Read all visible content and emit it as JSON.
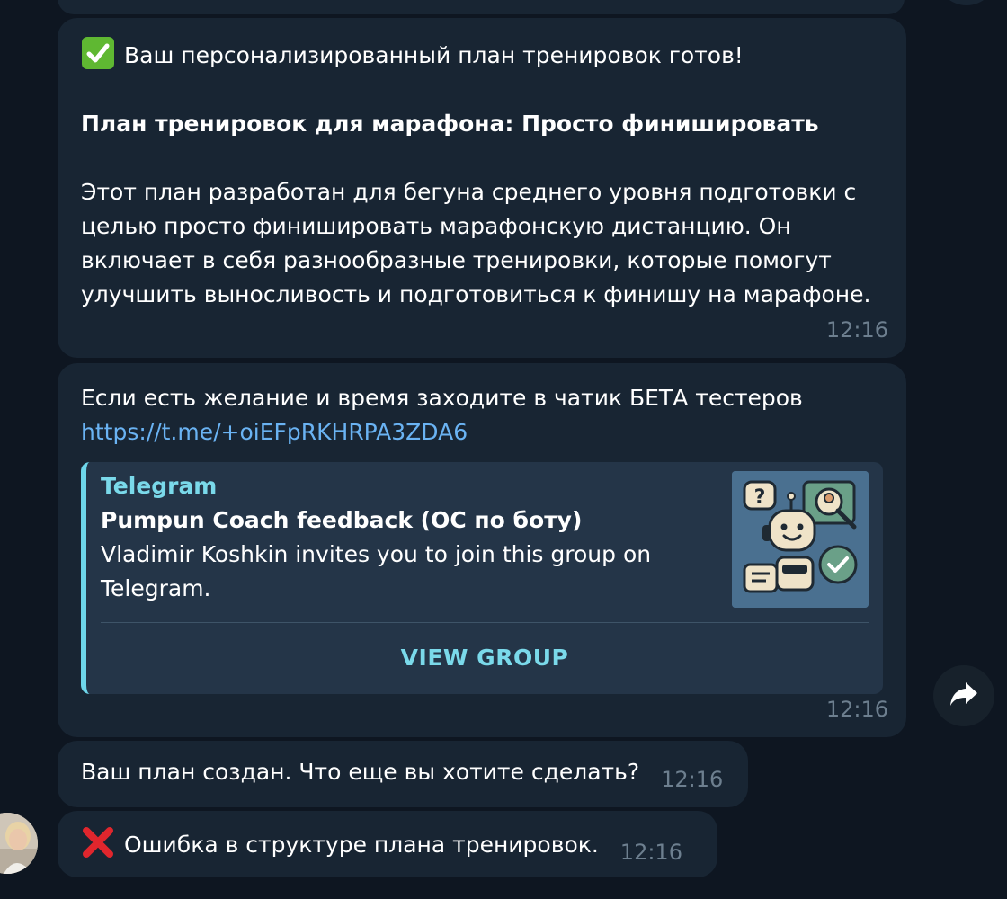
{
  "messages": {
    "plan": {
      "headline_emoji": "check-mark-emoji",
      "headline": "Ваш персонализированный план тренировок готов!",
      "title": "План тренировок для марафона: Просто финишировать",
      "body": "Этот план разработан для бегуна среднего уровня подготовки с целью просто финишировать марафонскую дистанцию. Он включает в себя разнообразные тренировки, которые помогут улучшить выносливость и подготовиться к финишу на марафоне.",
      "time": "12:16"
    },
    "invite": {
      "text": "Если есть желание и время заходите в чатик БЕТА тестеров",
      "link": "https://t.me/+oiEFpRKHRPA3ZDA6",
      "preview": {
        "site_name": "Telegram",
        "title": "Pumpun Coach feedback (ОС по боту)",
        "description": "Vladimir Koshkin invites you to join this group on Telegram.",
        "button": "VIEW GROUP"
      },
      "time": "12:16"
    },
    "created": {
      "text": "Ваш план создан. Что еще вы хотите сделать?",
      "time": "12:16"
    },
    "error": {
      "emoji": "cross-mark-emoji",
      "text": "Ошибка в структуре плана тренировок.",
      "time": "12:16"
    }
  },
  "colors": {
    "background": "#0e1621",
    "bubble": "#182533",
    "link": "#6ab3f3",
    "accent": "#6ed6ea",
    "meta": "#6d7f8f"
  },
  "icons": {
    "share": "forward-arrow-icon"
  }
}
